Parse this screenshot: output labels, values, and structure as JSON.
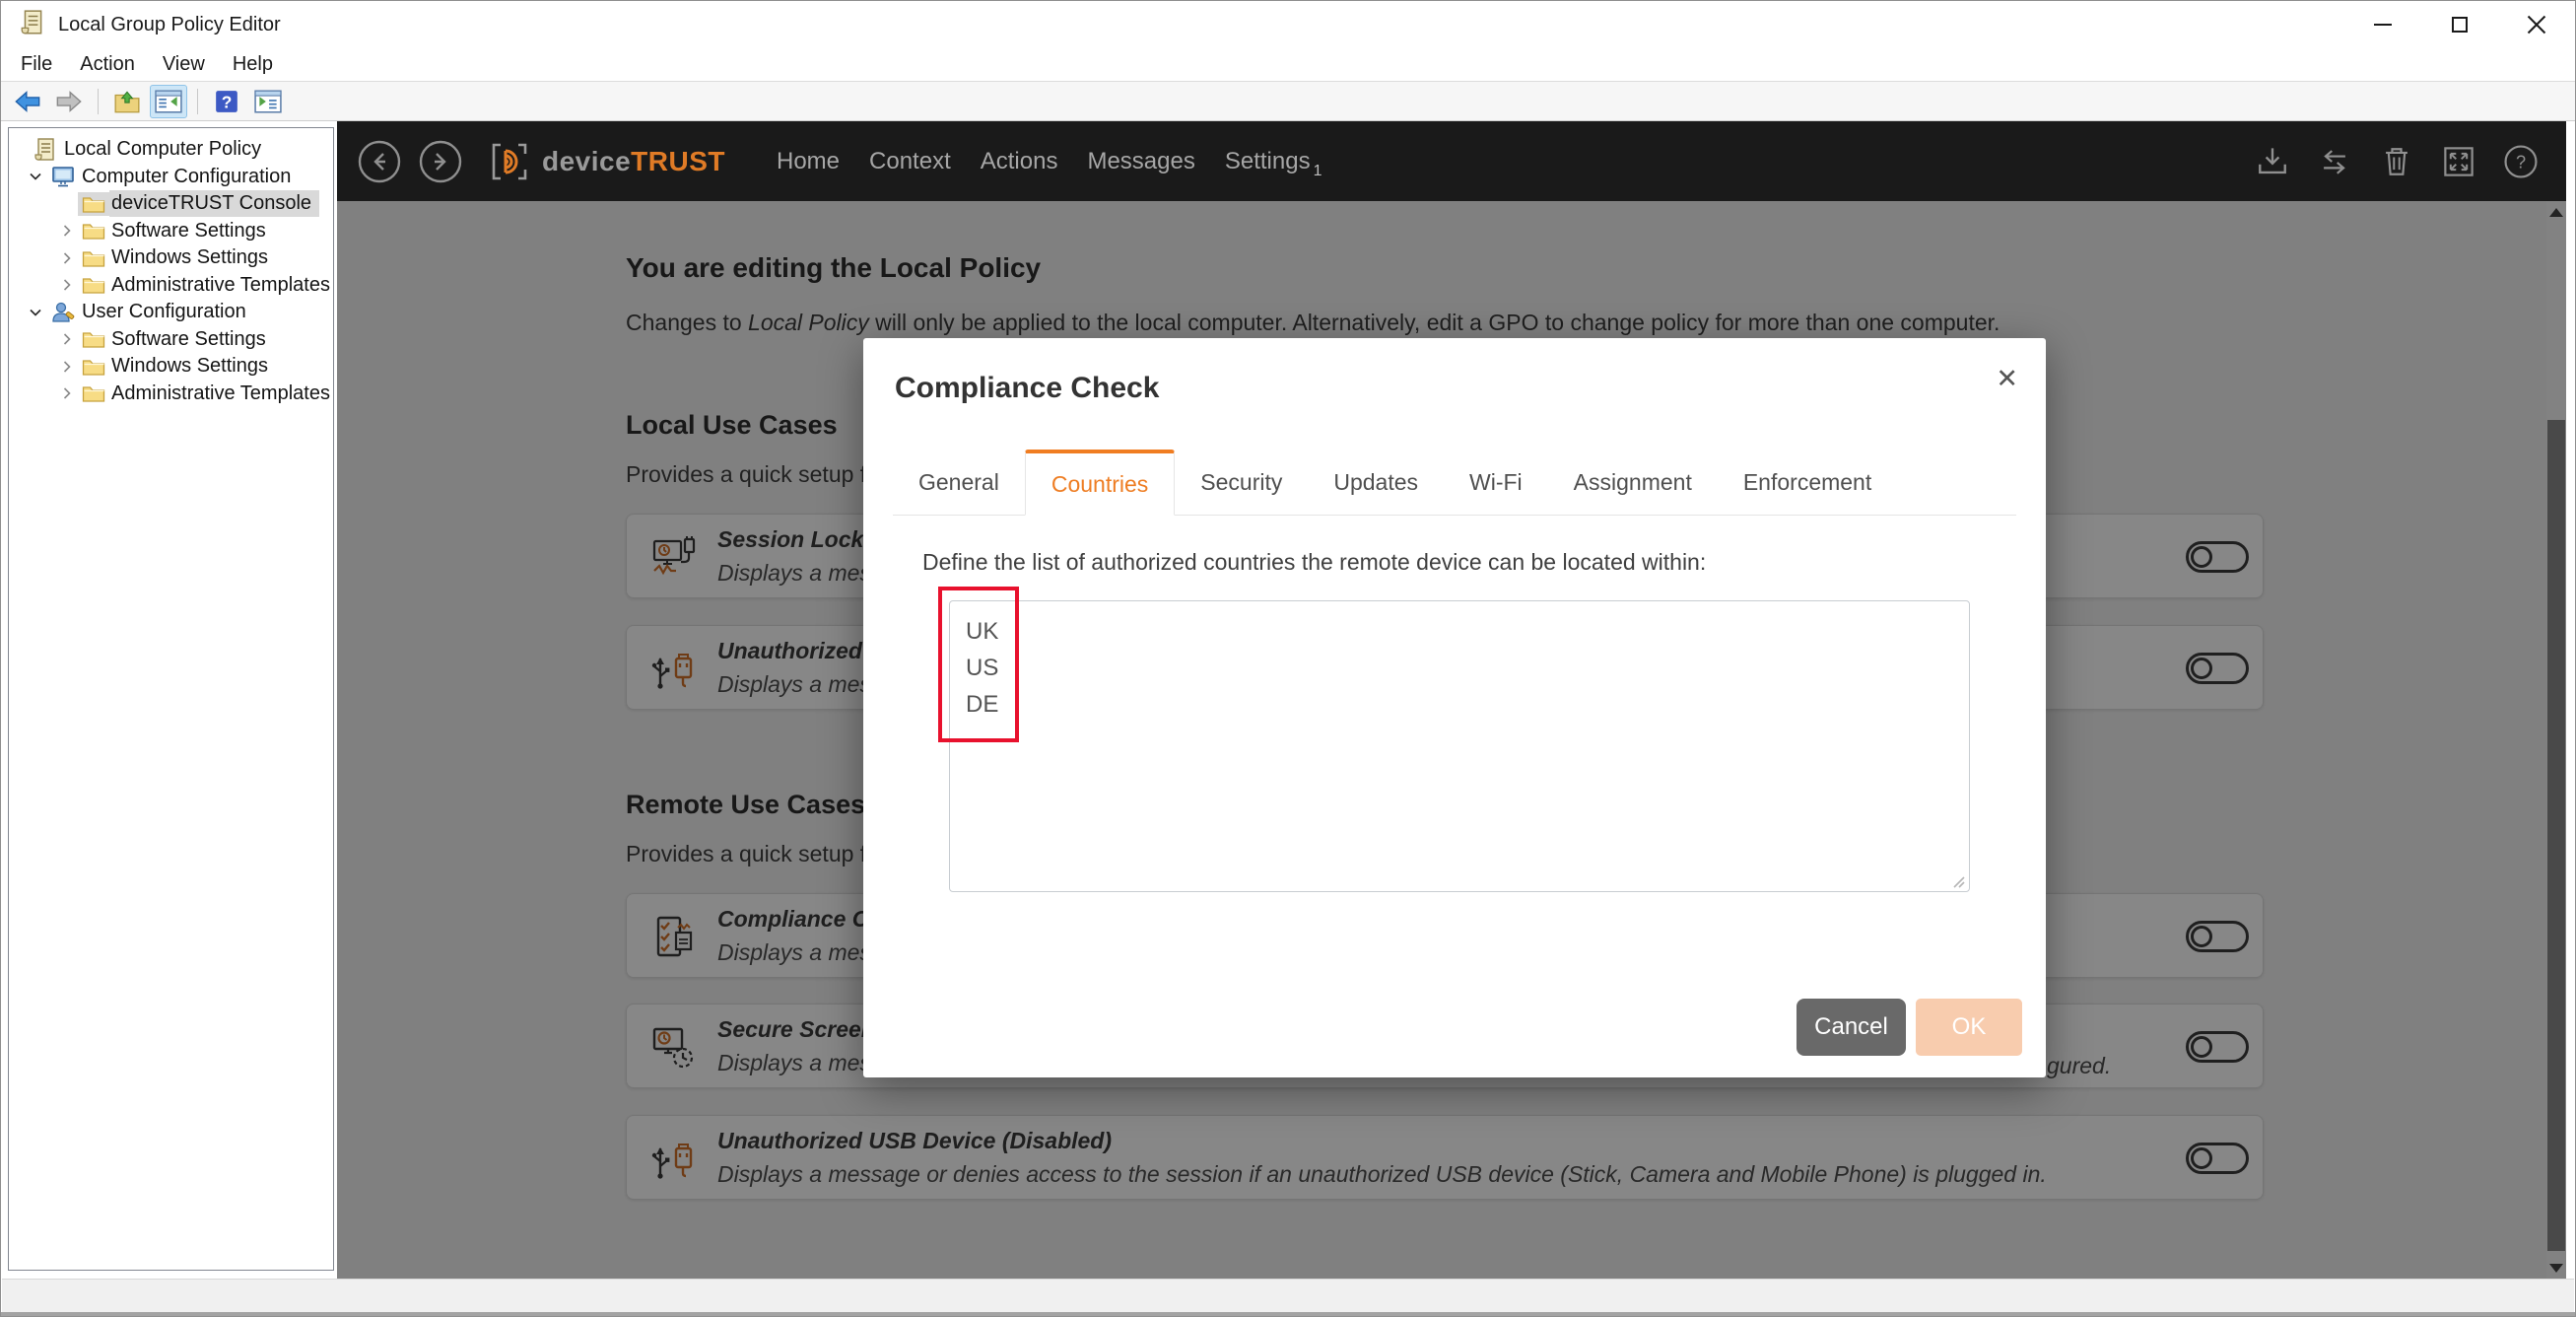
{
  "window": {
    "title": "Local Group Policy Editor",
    "menu": [
      "File",
      "Action",
      "View",
      "Help"
    ]
  },
  "tree": {
    "items": [
      {
        "label": "Local Computer Policy"
      },
      {
        "label": "Computer Configuration"
      },
      {
        "label": "deviceTRUST Console",
        "selected": true
      },
      {
        "label": "Software Settings"
      },
      {
        "label": "Windows Settings"
      },
      {
        "label": "Administrative Templates"
      },
      {
        "label": "User Configuration"
      },
      {
        "label": "Software Settings"
      },
      {
        "label": "Windows Settings"
      },
      {
        "label": "Administrative Templates"
      }
    ]
  },
  "console": {
    "brand": {
      "device": "device",
      "trust": "TRUST"
    },
    "nav": [
      "Home",
      "Context",
      "Actions",
      "Messages",
      "Settings"
    ],
    "settings_badge": "1",
    "page": {
      "title": "You are editing the Local Policy",
      "subtitle": {
        "prefix": "Changes to ",
        "italic": "Local Policy",
        "suffix": " will only be applied to the local computer. Alternatively, edit a GPO to change policy for more than one computer."
      },
      "sections": [
        {
          "heading": "Local Use Cases",
          "subheading": "Provides a quick setup f",
          "cards": [
            {
              "title": "Session Lock E",
              "description": "Displays a mes"
            },
            {
              "title": "Unauthorized",
              "description": "Displays a mes"
            }
          ]
        },
        {
          "heading": "Remote Use Cases",
          "subheading": "Provides a quick setup f",
          "cards": [
            {
              "title": "Compliance C",
              "description": "Displays a mes"
            },
            {
              "title": "Secure Screen",
              "description": "Displays a mes"
            }
          ]
        }
      ],
      "visible_fragment_right": "gured.",
      "wide_card": {
        "title": "Unauthorized USB Device (Disabled)",
        "description": "Displays a message or denies access to the session if an unauthorized USB device (Stick, Camera and Mobile Phone) is plugged in."
      }
    }
  },
  "dialog": {
    "title": "Compliance Check",
    "close": "✕",
    "tabs": [
      {
        "label": "General",
        "active": false
      },
      {
        "label": "Countries",
        "active": true
      },
      {
        "label": "Security",
        "active": false
      },
      {
        "label": "Updates",
        "active": false
      },
      {
        "label": "Wi-Fi",
        "active": false
      },
      {
        "label": "Assignment",
        "active": false
      },
      {
        "label": "Enforcement",
        "active": false
      }
    ],
    "instruction": "Define the list of authorized countries the remote device can be located within:",
    "countries_value": "UK\nUS\nDE",
    "buttons": {
      "cancel": "Cancel",
      "ok": "OK"
    },
    "annotation_color": "#e8112d"
  },
  "colors": {
    "accent_orange": "#ee7d23",
    "console_header_bg": "#1a1a1a",
    "annotation_red": "#e8112d",
    "cancel_button_bg": "#696969",
    "ok_button_bg": "#f8ccae"
  }
}
